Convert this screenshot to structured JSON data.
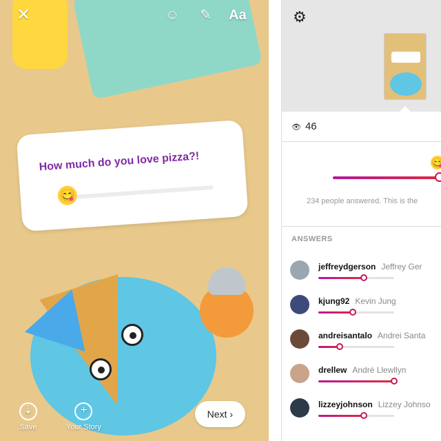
{
  "composer": {
    "close_icon": "✕",
    "sticker_icon": "☺",
    "draw_icon": "✎",
    "text_tool_label": "Aa",
    "poll_question": "How much do you love pizza?!",
    "poll_emoji": "😋",
    "save_label": "Save",
    "save_icon": "⇣",
    "your_story_label": "Your Story",
    "your_story_icon": "+",
    "next_label": "Next ›"
  },
  "results": {
    "settings_icon": "⚙",
    "view_icon": "👁",
    "view_count": "46",
    "summary_emoji": "😋",
    "answered_text": "234 people answered. This is the",
    "answers_heading": "ANSWERS",
    "answers": [
      {
        "username": "jeffreydgerson",
        "fullname": "Jeffrey Ger",
        "value": 0.6
      },
      {
        "username": "kjung92",
        "fullname": "Kevin Jung",
        "value": 0.45
      },
      {
        "username": "andreisantalo",
        "fullname": "Andrei Santa",
        "value": 0.28
      },
      {
        "username": "drellew",
        "fullname": "André Llewllyn",
        "value": 1.0
      },
      {
        "username": "lizzeyjohnson",
        "fullname": "Lizzey Johnso",
        "value": 0.6
      }
    ]
  }
}
